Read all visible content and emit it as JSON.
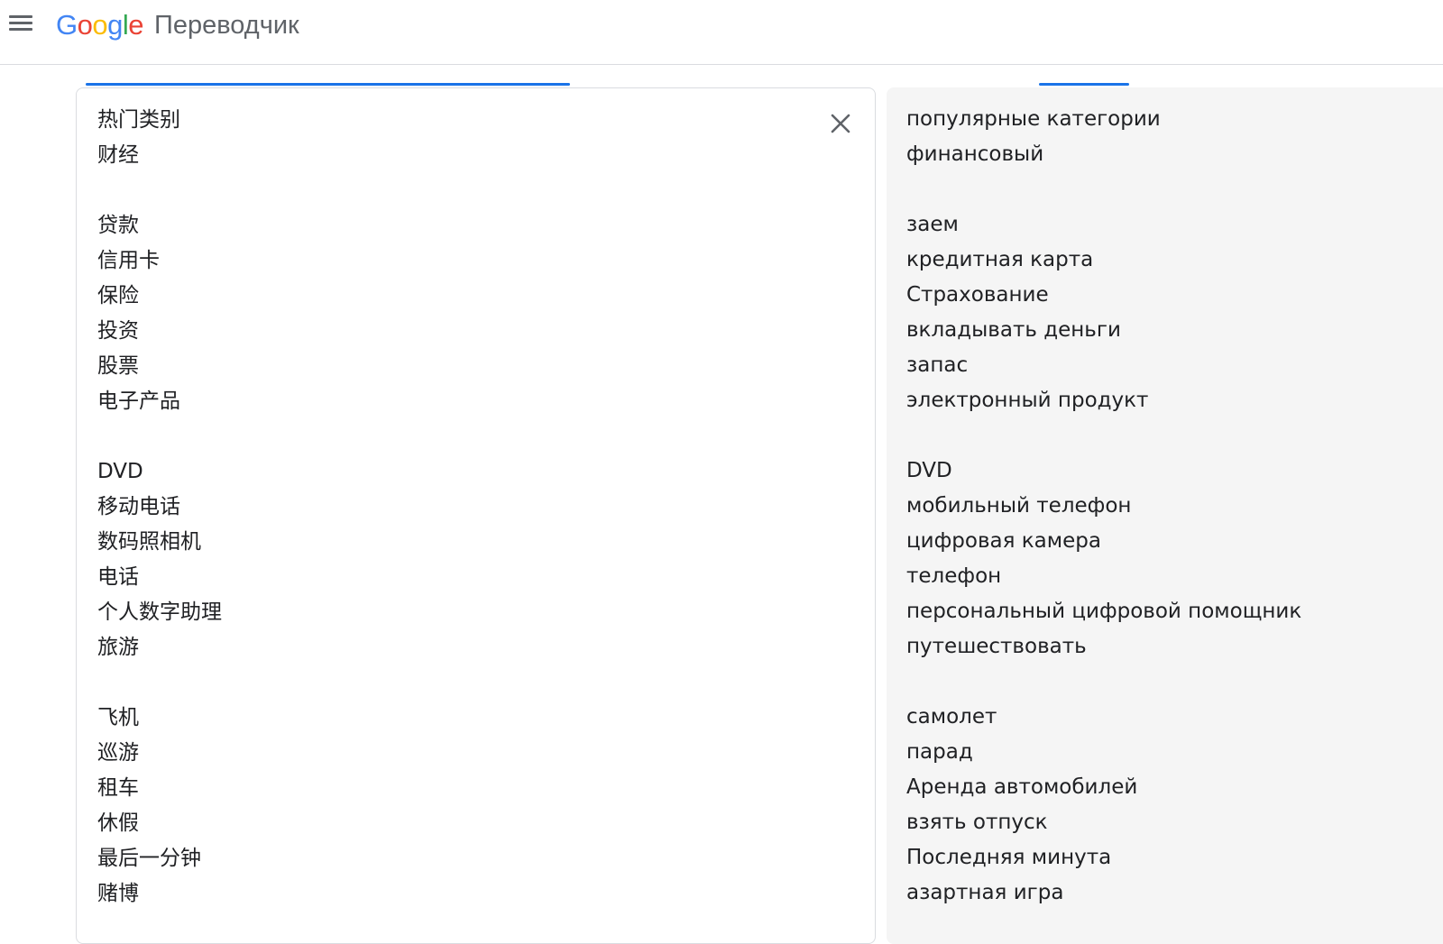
{
  "header": {
    "menu_icon": "hamburger-menu-icon",
    "logo_letters": [
      "G",
      "o",
      "o",
      "g",
      "l",
      "e"
    ],
    "product_name": "Переводчик"
  },
  "source": {
    "clear_icon": "close-icon",
    "lines": [
      "热门类别",
      "财经",
      "",
      "贷款",
      "信用卡",
      "保险",
      "投资",
      "股票",
      "电子产品",
      "",
      "DVD",
      "移动电话",
      "数码照相机",
      "电话",
      "个人数字助理",
      "旅游",
      "",
      "飞机",
      "巡游",
      "租车",
      "休假",
      "最后一分钟",
      "赌博"
    ]
  },
  "target": {
    "lines": [
      "популярные категории",
      "финансовый",
      "",
      "заем",
      "кредитная карта",
      "Страхование",
      "вкладывать деньги",
      "запас",
      "электронный продукт",
      "",
      "DVD",
      "мобильный телефон",
      "цифровая камера",
      "телефон",
      "персональный цифровой помощник",
      "путешествовать",
      "",
      "самолет",
      "парад",
      "Аренда автомобилей",
      "взять отпуск",
      "Последняя минута",
      "азартная игра"
    ]
  },
  "colors": {
    "accent": "#1a73e8",
    "target_bg": "#f5f5f5",
    "border": "#dadce0"
  }
}
